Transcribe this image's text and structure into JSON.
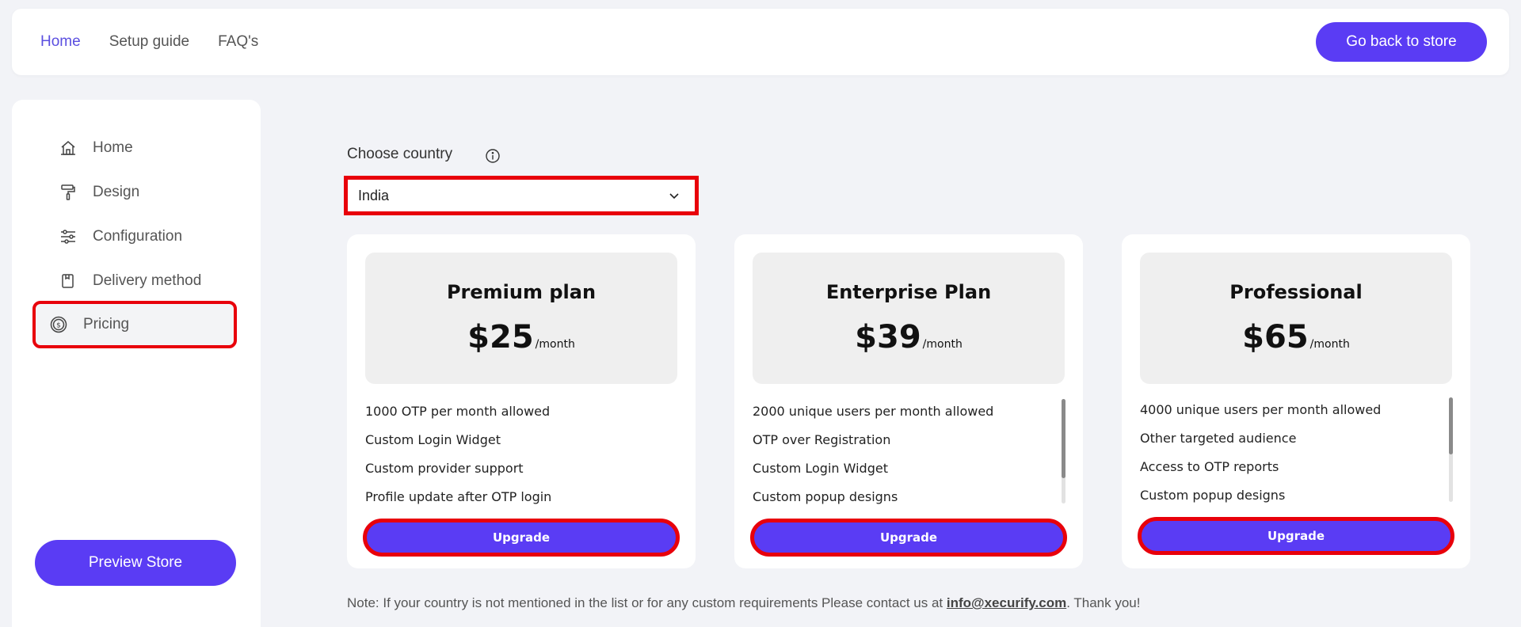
{
  "topnav": {
    "items": [
      "Home",
      "Setup guide",
      "FAQ's"
    ],
    "back_button": "Go back to store"
  },
  "sidebar": {
    "items": [
      {
        "label": "Home",
        "icon": "home-icon"
      },
      {
        "label": "Design",
        "icon": "paint-roller-icon"
      },
      {
        "label": "Configuration",
        "icon": "sliders-icon"
      },
      {
        "label": "Delivery method",
        "icon": "delivery-icon"
      },
      {
        "label": "Pricing",
        "icon": "dollar-coin-icon"
      }
    ],
    "selected": "Pricing",
    "preview_button": "Preview Store"
  },
  "country": {
    "label": "Choose country",
    "value": "India"
  },
  "plans": [
    {
      "name": "Premium plan",
      "price": "$25",
      "period": "/month",
      "features": [
        "1000 OTP per month allowed",
        "Custom Login Widget",
        "Custom provider support",
        "Profile update after OTP login"
      ],
      "button": "Upgrade"
    },
    {
      "name": "Enterprise Plan",
      "price": "$39",
      "period": "/month",
      "features": [
        "2000 unique users per month allowed",
        "OTP over Registration",
        "Custom Login Widget",
        "Custom popup designs"
      ],
      "button": "Upgrade"
    },
    {
      "name": "Professional",
      "price": "$65",
      "period": "/month",
      "features": [
        "4000 unique users per month allowed",
        "Other targeted audience",
        "Access to OTP reports",
        "Custom popup designs"
      ],
      "button": "Upgrade"
    }
  ],
  "note": {
    "text_before": "Note: If your country is not mentioned in the list or for any custom requirements Please contact us at ",
    "email": "info@xecurify.com",
    "text_after": ". Thank you!"
  },
  "colors": {
    "accent": "#5a3cf4",
    "highlight": "#e8000b",
    "active_nav": "#5b4fe0"
  }
}
